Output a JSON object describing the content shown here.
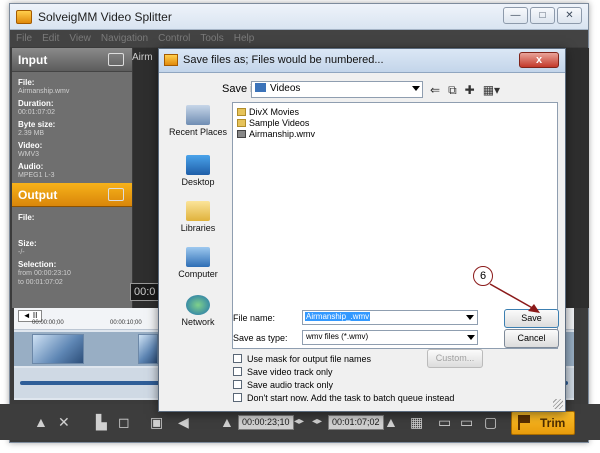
{
  "app": {
    "title": "SolveigMM Video Splitter",
    "menu": [
      "File",
      "Edit",
      "View",
      "Navigation",
      "Control",
      "Tools",
      "Help"
    ],
    "monitor_label": "Airm",
    "monitor_time": "00:0"
  },
  "input_panel": {
    "heading": "Input",
    "fields": [
      {
        "key": "File:",
        "value": "Airmanship.wmv"
      },
      {
        "key": "Duration:",
        "value": "00:01:07:02"
      },
      {
        "key": "Byte size:",
        "value": "2.39 MB"
      },
      {
        "key": "Video:",
        "value": "WMV3"
      },
      {
        "key": "Audio:",
        "value": "MPEG1 L-3"
      }
    ]
  },
  "output_panel": {
    "heading": "Output",
    "fields": [
      {
        "key": "File:",
        "value": ""
      },
      {
        "key": "Size:",
        "value": "-/-"
      },
      {
        "key": "Selection:",
        "value": "from 00:00:23:10"
      },
      {
        "key": "",
        "value": "to    00:01:07:02"
      }
    ]
  },
  "timeline": {
    "nav_button": "◄ II",
    "ticks": [
      "00:00:00;00",
      "00:00:10;00"
    ]
  },
  "bottombar": {
    "start_time": "00:00:23;10",
    "end_time": "00:01:07;02",
    "trim_label": "Trim"
  },
  "dialog": {
    "title": "Save files as; Files would be numbered...",
    "close_label": "x",
    "save_in_label": "Save in:",
    "save_in_value": "Videos",
    "places": [
      "Recent Places",
      "Desktop",
      "Libraries",
      "Computer",
      "Network"
    ],
    "files": [
      {
        "name": "DivX Movies",
        "kind": "folder"
      },
      {
        "name": "Sample Videos",
        "kind": "folder"
      },
      {
        "name": "Airmanship.wmv",
        "kind": "video"
      }
    ],
    "file_name_label": "File name:",
    "file_name_value": "Airmanship_.wmv",
    "save_as_type_label": "Save as type:",
    "save_as_type_value": "wmv files (*.wmv)",
    "save_button": "Save",
    "cancel_button": "Cancel",
    "custom_button": "Custom...",
    "options": [
      "Use mask for output file names",
      "Save video track only",
      "Save audio track only",
      "Don't start now. Add the task to batch queue instead"
    ]
  },
  "annotation": {
    "step": "6"
  },
  "colors": {
    "accent": "#f0a012",
    "dialog_bg": "#f0f0f0",
    "selection": "#3399ff"
  }
}
